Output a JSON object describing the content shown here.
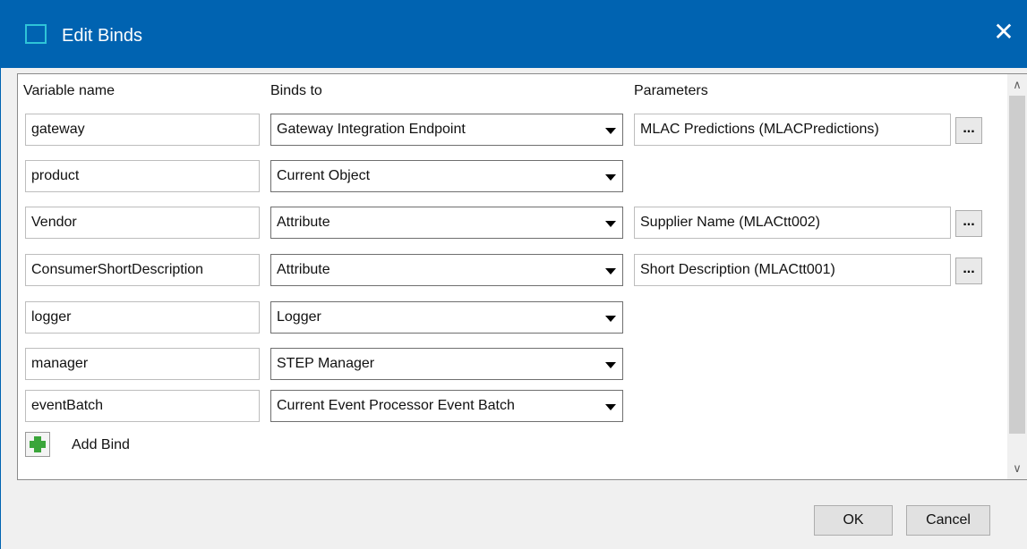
{
  "window": {
    "title": "Edit Binds",
    "close_symbol": "✕"
  },
  "headers": {
    "variable": "Variable name",
    "binds": "Binds to",
    "params": "Parameters"
  },
  "rows": [
    {
      "variable": "gateway",
      "binds": "Gateway Integration Endpoint",
      "params": "MLAC Predictions (MLACPredictions)"
    },
    {
      "variable": "product",
      "binds": "Current Object",
      "params": ""
    },
    {
      "variable": "Vendor",
      "binds": "Attribute",
      "params": "Supplier Name (MLACtt002)"
    },
    {
      "variable": "ConsumerShortDescription",
      "binds": "Attribute",
      "params": "Short Description (MLACtt001)"
    },
    {
      "variable": "logger",
      "binds": "Logger",
      "params": ""
    },
    {
      "variable": "manager",
      "binds": "STEP Manager",
      "params": ""
    },
    {
      "variable": "eventBatch",
      "binds": "Current Event Processor Event Batch",
      "params": ""
    }
  ],
  "browse_label": "...",
  "add_bind_label": "Add Bind",
  "buttons": {
    "ok": "OK",
    "cancel": "Cancel"
  },
  "scrollbar": {
    "up": "∧",
    "down": "∨"
  },
  "colors": {
    "titlebar": "#0063b1",
    "icon_border": "#2ec4d8",
    "add_icon": "#3aa53a"
  }
}
